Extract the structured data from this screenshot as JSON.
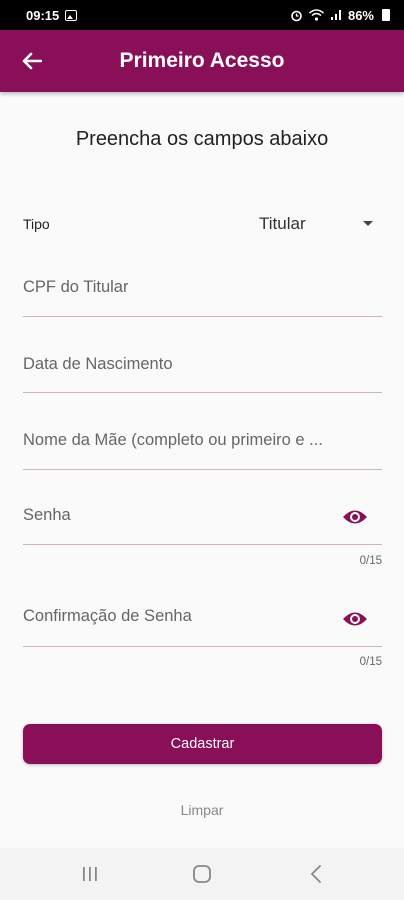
{
  "status_bar": {
    "time": "09:15",
    "battery": "86%",
    "icons": [
      "image-icon",
      "alarm-icon",
      "wifi-icon",
      "signal-icon",
      "battery-icon"
    ]
  },
  "app_bar": {
    "title": "Primeiro Acesso",
    "back_icon": "arrow-left-icon",
    "color": "#8a0f59"
  },
  "form": {
    "heading": "Preencha os campos abaixo",
    "tipo": {
      "label": "Tipo",
      "value": "Titular"
    },
    "cpf": {
      "placeholder": "CPF do Titular"
    },
    "nascimento": {
      "placeholder": "Data de Nascimento"
    },
    "mae": {
      "placeholder": "Nome da Mãe (completo ou primeiro e ..."
    },
    "senha": {
      "placeholder": "Senha",
      "counter": "0/15"
    },
    "confirmacao": {
      "placeholder": "Confirmação de Senha",
      "counter": "0/15"
    },
    "submit_label": "Cadastrar",
    "clear_label": "Limpar"
  },
  "nav_bar": {
    "icons": [
      "recent-apps-icon",
      "home-icon",
      "back-icon"
    ]
  }
}
